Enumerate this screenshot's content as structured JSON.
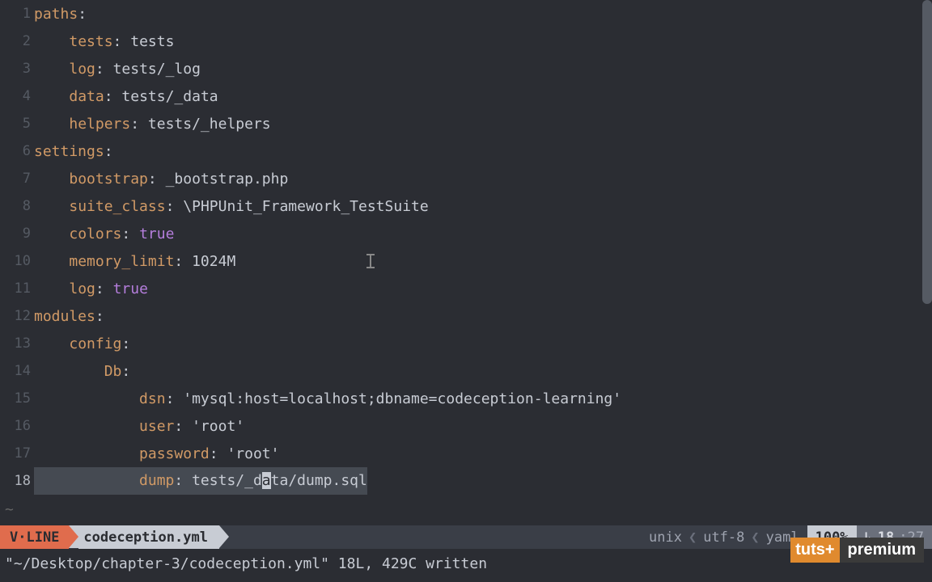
{
  "colors": {
    "bg": "#2b2d33",
    "accent": "#e06c4d",
    "key": "#d19a66",
    "bool": "#b57edc"
  },
  "lines": [
    {
      "n": 1,
      "indent": 0,
      "key": "paths",
      "sep": ":",
      "val": ""
    },
    {
      "n": 2,
      "indent": 1,
      "key": "tests",
      "sep": ": ",
      "val": "tests"
    },
    {
      "n": 3,
      "indent": 1,
      "key": "log",
      "sep": ": ",
      "val": "tests/_log"
    },
    {
      "n": 4,
      "indent": 1,
      "key": "data",
      "sep": ": ",
      "val": "tests/_data"
    },
    {
      "n": 5,
      "indent": 1,
      "key": "helpers",
      "sep": ": ",
      "val": "tests/_helpers"
    },
    {
      "n": 6,
      "indent": 0,
      "key": "settings",
      "sep": ":",
      "val": ""
    },
    {
      "n": 7,
      "indent": 1,
      "key": "bootstrap",
      "sep": ": ",
      "val": "_bootstrap.php"
    },
    {
      "n": 8,
      "indent": 1,
      "key": "suite_class",
      "sep": ": ",
      "val": "\\PHPUnit_Framework_TestSuite"
    },
    {
      "n": 9,
      "indent": 1,
      "key": "colors",
      "sep": ": ",
      "val": "true",
      "bool": true
    },
    {
      "n": 10,
      "indent": 1,
      "key": "memory_limit",
      "sep": ": ",
      "val": "1024M"
    },
    {
      "n": 11,
      "indent": 1,
      "key": "log",
      "sep": ": ",
      "val": "true",
      "bool": true
    },
    {
      "n": 12,
      "indent": 0,
      "key": "modules",
      "sep": ":",
      "val": ""
    },
    {
      "n": 13,
      "indent": 1,
      "key": "config",
      "sep": ":",
      "val": ""
    },
    {
      "n": 14,
      "indent": 2,
      "key": "Db",
      "sep": ":",
      "val": ""
    },
    {
      "n": 15,
      "indent": 3,
      "key": "dsn",
      "sep": ": ",
      "val": "'mysql:host=localhost;dbname=codeception-learning'"
    },
    {
      "n": 16,
      "indent": 3,
      "key": "user",
      "sep": ": ",
      "val": "'root'"
    },
    {
      "n": 17,
      "indent": 3,
      "key": "password",
      "sep": ": ",
      "val": "'root'"
    },
    {
      "n": 18,
      "indent": 3,
      "key": "dump",
      "sep": ": ",
      "val_pre": "tests/_d",
      "val_cur": "a",
      "val_post": "ta/dump.sql",
      "selected": true
    }
  ],
  "tilde": "~",
  "status": {
    "mode": "V·LINE",
    "filename": "codeception.yml",
    "encoding_left": "unix",
    "encoding_mid": "utf-8",
    "filetype": "yaml",
    "percent": "100%",
    "line": "18",
    "col": ":27"
  },
  "cmdline": "\"~/Desktop/chapter-3/codeception.yml\" 18L, 429C written",
  "watermark": {
    "left": "tuts+",
    "right": "premium"
  }
}
